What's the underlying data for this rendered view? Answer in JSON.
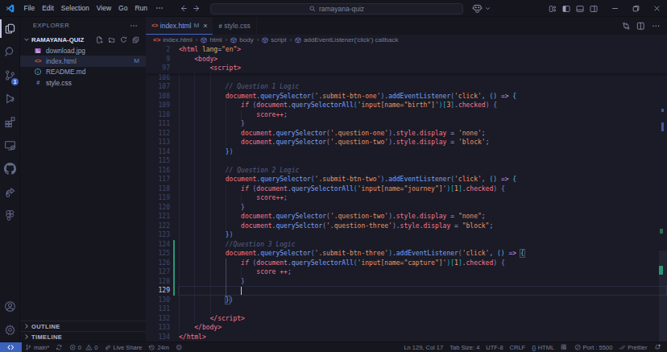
{
  "title_bar": {
    "menus": [
      "File",
      "Edit",
      "Selection",
      "View",
      "Go",
      "Run"
    ],
    "menu_overflow": "⋯",
    "search_value": "ramayana-quiz"
  },
  "activity_bar": {
    "items": [
      {
        "icon": "files",
        "active": true
      },
      {
        "icon": "search",
        "active": false
      },
      {
        "icon": "source-control",
        "active": false,
        "badge": "1"
      },
      {
        "icon": "run-debug",
        "active": false
      },
      {
        "icon": "extensions",
        "active": false
      },
      {
        "icon": "remote-explorer",
        "active": false
      },
      {
        "icon": "github",
        "active": false
      },
      {
        "icon": "live-share",
        "active": false
      },
      {
        "icon": "figma",
        "active": false
      }
    ],
    "bottom_items": [
      {
        "icon": "account"
      },
      {
        "icon": "settings-gear"
      }
    ]
  },
  "sidebar": {
    "header": "EXPLORER",
    "project": "RAMAYANA-QUIZ",
    "files": [
      {
        "name": "download.jpg",
        "icon": "image",
        "selected": false,
        "badge": ""
      },
      {
        "name": "index.html",
        "icon": "html",
        "selected": true,
        "badge": "M",
        "modified": true
      },
      {
        "name": "README.md",
        "icon": "info",
        "selected": false,
        "badge": ""
      },
      {
        "name": "style.css",
        "icon": "css",
        "selected": false,
        "badge": ""
      }
    ],
    "sections": [
      "OUTLINE",
      "TIMELINE"
    ]
  },
  "tabs": [
    {
      "label": "index.html",
      "icon": "html",
      "badge": "M",
      "close": "×",
      "active": true
    },
    {
      "label": "style.css",
      "icon": "css",
      "active": false
    }
  ],
  "breadcrumbs": [
    {
      "icon": "html-file",
      "label": "index.html"
    },
    {
      "icon": "symbol-cube",
      "label": "html"
    },
    {
      "icon": "symbol-cube",
      "label": "body"
    },
    {
      "icon": "symbol-cube",
      "label": "script"
    },
    {
      "icon": "symbol-cube",
      "label": "addEventListener('click') callback"
    }
  ],
  "editor": {
    "sticky_lines": [
      {
        "num": 2,
        "tokens": [
          [
            "tag",
            "<html"
          ],
          [
            "fg",
            " "
          ],
          [
            "attr",
            "lang"
          ],
          [
            "pun",
            "="
          ],
          [
            "str",
            "\"en\""
          ],
          [
            "tag",
            ">"
          ]
        ]
      },
      {
        "num": 9,
        "tokens": [
          [
            "tag",
            "    <body>"
          ]
        ]
      },
      {
        "num": 97,
        "tokens": [
          [
            "tag",
            "        <script>"
          ]
        ]
      }
    ],
    "lines": [
      {
        "num": 106,
        "tokens": []
      },
      {
        "num": 107,
        "tokens": [
          [
            "cmt",
            "            // Question 1 Logic"
          ]
        ]
      },
      {
        "num": 108,
        "tokens": [
          [
            "fg",
            "            "
          ],
          [
            "red",
            "document"
          ],
          [
            "pun",
            "."
          ],
          [
            "blue",
            "querySelector"
          ],
          [
            "d1",
            "("
          ],
          [
            "str",
            "'.submit-btn-one'"
          ],
          [
            "d1",
            ")"
          ],
          [
            "pun",
            "."
          ],
          [
            "blue",
            "addEventListener"
          ],
          [
            "d1",
            "("
          ],
          [
            "str",
            "'click'"
          ],
          [
            "pun",
            ","
          ],
          [
            "fg",
            " "
          ],
          [
            "d2",
            "()"
          ],
          [
            "fg",
            " "
          ],
          [
            "arrow",
            "=>"
          ],
          [
            "fg",
            " "
          ],
          [
            "d2",
            "{"
          ]
        ]
      },
      {
        "num": 109,
        "tokens": [
          [
            "fg",
            "                "
          ],
          [
            "kw",
            "if"
          ],
          [
            "fg",
            " "
          ],
          [
            "d3",
            "("
          ],
          [
            "red",
            "document"
          ],
          [
            "pun",
            "."
          ],
          [
            "blue",
            "querySelectorAll"
          ],
          [
            "d4",
            "("
          ],
          [
            "str",
            "'input[name=\"birth\"]'"
          ],
          [
            "d4",
            ")"
          ],
          [
            "d4",
            "["
          ],
          [
            "num",
            "3"
          ],
          [
            "d4",
            "]"
          ],
          [
            "pun",
            "."
          ],
          [
            "red",
            "checked"
          ],
          [
            "d3",
            ")"
          ],
          [
            "fg",
            " "
          ],
          [
            "d3",
            "{"
          ]
        ]
      },
      {
        "num": 110,
        "tokens": [
          [
            "fg",
            "                    "
          ],
          [
            "red",
            "score"
          ],
          [
            "red",
            "++"
          ],
          [
            "pun",
            ";"
          ]
        ]
      },
      {
        "num": 111,
        "tokens": [
          [
            "fg",
            "                "
          ],
          [
            "d3",
            "}"
          ]
        ]
      },
      {
        "num": 112,
        "tokens": [
          [
            "fg",
            "                "
          ],
          [
            "red",
            "document"
          ],
          [
            "pun",
            "."
          ],
          [
            "blue",
            "querySelector"
          ],
          [
            "d3",
            "("
          ],
          [
            "str",
            "'.question-one'"
          ],
          [
            "d3",
            ")"
          ],
          [
            "pun",
            "."
          ],
          [
            "red",
            "style"
          ],
          [
            "pun",
            "."
          ],
          [
            "red",
            "display"
          ],
          [
            "fg",
            " "
          ],
          [
            "op",
            "="
          ],
          [
            "fg",
            " "
          ],
          [
            "str",
            "'none'"
          ],
          [
            "pun",
            ";"
          ]
        ]
      },
      {
        "num": 113,
        "tokens": [
          [
            "fg",
            "                "
          ],
          [
            "red",
            "document"
          ],
          [
            "pun",
            "."
          ],
          [
            "blue",
            "querySelector"
          ],
          [
            "d3",
            "("
          ],
          [
            "str",
            "'.question-two'"
          ],
          [
            "d3",
            ")"
          ],
          [
            "pun",
            "."
          ],
          [
            "red",
            "style"
          ],
          [
            "pun",
            "."
          ],
          [
            "red",
            "display"
          ],
          [
            "fg",
            " "
          ],
          [
            "op",
            "="
          ],
          [
            "fg",
            " "
          ],
          [
            "str",
            "'block'"
          ],
          [
            "pun",
            ";"
          ]
        ]
      },
      {
        "num": 114,
        "tokens": [
          [
            "fg",
            "            "
          ],
          [
            "d2",
            "}"
          ],
          [
            "d1",
            ")"
          ]
        ]
      },
      {
        "num": 115,
        "tokens": []
      },
      {
        "num": 116,
        "tokens": [
          [
            "cmt",
            "            // Question 2 Logic"
          ]
        ]
      },
      {
        "num": 117,
        "tokens": [
          [
            "fg",
            "            "
          ],
          [
            "red",
            "document"
          ],
          [
            "pun",
            "."
          ],
          [
            "blue",
            "querySelector"
          ],
          [
            "d1",
            "("
          ],
          [
            "str",
            "'.submit-btn-two'"
          ],
          [
            "d1",
            ")"
          ],
          [
            "pun",
            "."
          ],
          [
            "blue",
            "addEventListener"
          ],
          [
            "d1",
            "("
          ],
          [
            "str",
            "'click'"
          ],
          [
            "pun",
            ","
          ],
          [
            "fg",
            " "
          ],
          [
            "d2",
            "()"
          ],
          [
            "fg",
            " "
          ],
          [
            "arrow",
            "=>"
          ],
          [
            "fg",
            " "
          ],
          [
            "d2",
            "{"
          ]
        ]
      },
      {
        "num": 118,
        "tokens": [
          [
            "fg",
            "                "
          ],
          [
            "kw",
            "if"
          ],
          [
            "fg",
            " "
          ],
          [
            "d3",
            "("
          ],
          [
            "red",
            "document"
          ],
          [
            "pun",
            "."
          ],
          [
            "blue",
            "querySelectorAll"
          ],
          [
            "d4",
            "("
          ],
          [
            "str",
            "'input[name=\"journey\"]'"
          ],
          [
            "d4",
            ")"
          ],
          [
            "d4",
            "["
          ],
          [
            "num",
            "1"
          ],
          [
            "d4",
            "]"
          ],
          [
            "pun",
            "."
          ],
          [
            "red",
            "checked"
          ],
          [
            "d3",
            ")"
          ],
          [
            "fg",
            " "
          ],
          [
            "d3",
            "{"
          ]
        ]
      },
      {
        "num": 119,
        "tokens": [
          [
            "fg",
            "                    "
          ],
          [
            "red",
            "score"
          ],
          [
            "red",
            "++"
          ],
          [
            "pun",
            ";"
          ]
        ]
      },
      {
        "num": 120,
        "tokens": [
          [
            "fg",
            "                "
          ],
          [
            "d3",
            "}"
          ]
        ]
      },
      {
        "num": 121,
        "tokens": [
          [
            "fg",
            "                "
          ],
          [
            "red",
            "document"
          ],
          [
            "pun",
            "."
          ],
          [
            "blue",
            "querySelector"
          ],
          [
            "d3",
            "("
          ],
          [
            "str",
            "'.question-two'"
          ],
          [
            "d3",
            ")"
          ],
          [
            "pun",
            "."
          ],
          [
            "red",
            "style"
          ],
          [
            "pun",
            "."
          ],
          [
            "red",
            "display"
          ],
          [
            "fg",
            " "
          ],
          [
            "op",
            "="
          ],
          [
            "fg",
            " "
          ],
          [
            "str",
            "\"none\""
          ],
          [
            "pun",
            ";"
          ]
        ]
      },
      {
        "num": 122,
        "tokens": [
          [
            "fg",
            "                "
          ],
          [
            "red",
            "document"
          ],
          [
            "pun",
            "."
          ],
          [
            "blue",
            "querySelctor"
          ],
          [
            "d3",
            "("
          ],
          [
            "str",
            "'.question-three'"
          ],
          [
            "d3",
            ")"
          ],
          [
            "pun",
            "."
          ],
          [
            "red",
            "style"
          ],
          [
            "pun",
            "."
          ],
          [
            "red",
            "display"
          ],
          [
            "fg",
            " "
          ],
          [
            "op",
            "="
          ],
          [
            "fg",
            " "
          ],
          [
            "str",
            "\"block\""
          ],
          [
            "pun",
            ";"
          ]
        ]
      },
      {
        "num": 123,
        "tokens": [
          [
            "fg",
            "            "
          ],
          [
            "d2",
            "}"
          ],
          [
            "d1",
            ")"
          ]
        ]
      },
      {
        "num": 124,
        "tokens": [
          [
            "cmt",
            "            //Question 3 Logic"
          ]
        ]
      },
      {
        "num": 125,
        "tokens": [
          [
            "fg",
            "            "
          ],
          [
            "red",
            "document"
          ],
          [
            "pun",
            "."
          ],
          [
            "blue",
            "querySelector"
          ],
          [
            "d1",
            "("
          ],
          [
            "str",
            "'.submit-btn-three'"
          ],
          [
            "d1",
            ")"
          ],
          [
            "pun",
            "."
          ],
          [
            "blue",
            "addEventListener"
          ],
          [
            "d1",
            "("
          ],
          [
            "str",
            "'click'"
          ],
          [
            "pun",
            ","
          ],
          [
            "fg",
            " "
          ],
          [
            "d2",
            "()"
          ],
          [
            "fg",
            " "
          ],
          [
            "arrow",
            "=>"
          ],
          [
            "fg",
            " "
          ],
          [
            "d2 match",
            "{"
          ]
        ]
      },
      {
        "num": 126,
        "tokens": [
          [
            "fg",
            "                "
          ],
          [
            "kw",
            "if"
          ],
          [
            "fg",
            " "
          ],
          [
            "d3",
            "("
          ],
          [
            "red",
            "document"
          ],
          [
            "pun",
            "."
          ],
          [
            "blue",
            "querySelectorAll"
          ],
          [
            "d4",
            "("
          ],
          [
            "str",
            "'input[name=\"capture\"]'"
          ],
          [
            "d4",
            ")"
          ],
          [
            "d4",
            "["
          ],
          [
            "num",
            "1"
          ],
          [
            "d4",
            "]"
          ],
          [
            "pun",
            "."
          ],
          [
            "red",
            "checked"
          ],
          [
            "d3",
            ")"
          ],
          [
            "fg",
            " "
          ],
          [
            "d3",
            "{"
          ]
        ]
      },
      {
        "num": 127,
        "tokens": [
          [
            "fg",
            "                    "
          ],
          [
            "red",
            "score"
          ],
          [
            "fg",
            " "
          ],
          [
            "red",
            "++"
          ],
          [
            "pun",
            ";"
          ]
        ]
      },
      {
        "num": 128,
        "tokens": [
          [
            "fg",
            "                "
          ],
          [
            "d3",
            "}"
          ]
        ]
      },
      {
        "num": 129,
        "tokens": []
      },
      {
        "num": 130,
        "tokens": [
          [
            "fg",
            "            "
          ],
          [
            "d2 match",
            "}"
          ],
          [
            "d1",
            ")"
          ]
        ]
      },
      {
        "num": 131,
        "tokens": []
      },
      {
        "num": 132,
        "tokens": [
          [
            "tag",
            "        </script>"
          ]
        ]
      },
      {
        "num": 133,
        "tokens": [
          [
            "tag",
            "    </body>"
          ]
        ]
      },
      {
        "num": 134,
        "tokens": [
          [
            "tag",
            "</html>"
          ]
        ]
      }
    ],
    "cursor": {
      "line": 129,
      "col": 17
    },
    "current_line": 129,
    "git_added_lines": {
      "from": 124,
      "to": 129
    }
  },
  "status_bar": {
    "left": [
      {
        "icon": "branch",
        "label": "main*",
        "name": "git-branch"
      },
      {
        "icon": "sync",
        "label": "",
        "name": "sync"
      },
      {
        "icon": "error",
        "label": "0",
        "icon2": "warning",
        "label2": "0",
        "name": "problems"
      },
      {
        "icon": "live-share",
        "label": "Live Share",
        "name": "live-share"
      },
      {
        "icon": "history",
        "label": "24m",
        "name": "timer"
      },
      {
        "icon": "smiley",
        "label": "",
        "name": "feedback"
      }
    ],
    "right": [
      {
        "label": "Ln 129, Col 17",
        "name": "cursor-position"
      },
      {
        "label": "Tab Size: 4",
        "name": "indentation"
      },
      {
        "label": "UTF-8",
        "name": "encoding"
      },
      {
        "label": "CRLF",
        "name": "eol"
      },
      {
        "icon": "braces",
        "label": "HTML",
        "name": "language-mode"
      },
      {
        "icon": "ext-gear",
        "label": "",
        "name": "extension-status"
      },
      {
        "icon": "circle-slash",
        "label": "Port : 5500",
        "name": "live-server-port"
      },
      {
        "icon": "double-check",
        "label": "Prettier",
        "name": "prettier"
      },
      {
        "icon": "bell",
        "label": "",
        "name": "notifications"
      }
    ]
  },
  "colors": {
    "accent_blue": "#3b62bc",
    "tab_active_border": "#4468c4",
    "git_modified": "#6183bb",
    "git_added_gutter": "#2c9678"
  }
}
